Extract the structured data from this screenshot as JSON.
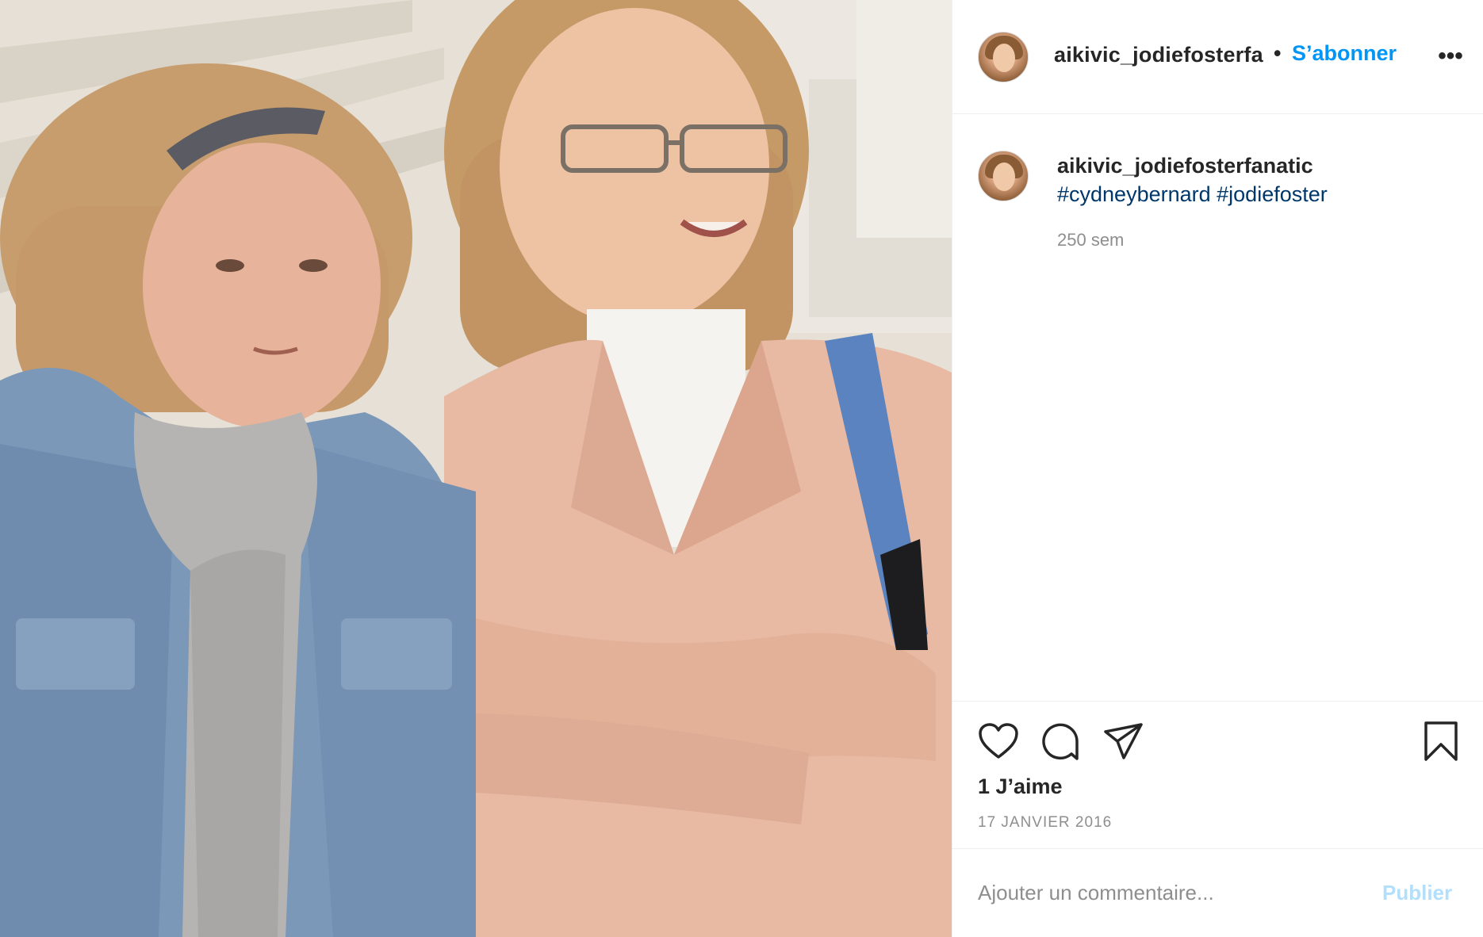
{
  "header": {
    "username": "aikivic_jodiefosterfa",
    "separator": "•",
    "follow_label": "S’abonner",
    "more_label": "•••"
  },
  "caption": {
    "username": "aikivic_jodiefosterfanatic",
    "hashtags": [
      "#cydneybernard",
      "#jodiefoster"
    ],
    "time_ago": "250 sem"
  },
  "actions": {
    "icons": [
      "heart-icon",
      "comment-icon",
      "share-icon",
      "bookmark-icon"
    ],
    "likes": "1 J’aime",
    "date": "17 JANVIER 2016"
  },
  "comment": {
    "placeholder": "Ajouter un commentaire...",
    "publish_label": "Publier"
  },
  "colors": {
    "link_blue": "#0095f6",
    "hashtag_blue": "#00376b",
    "muted": "#8e8e8e",
    "publish_disabled": "#b2dffc",
    "divider": "#efefef"
  }
}
